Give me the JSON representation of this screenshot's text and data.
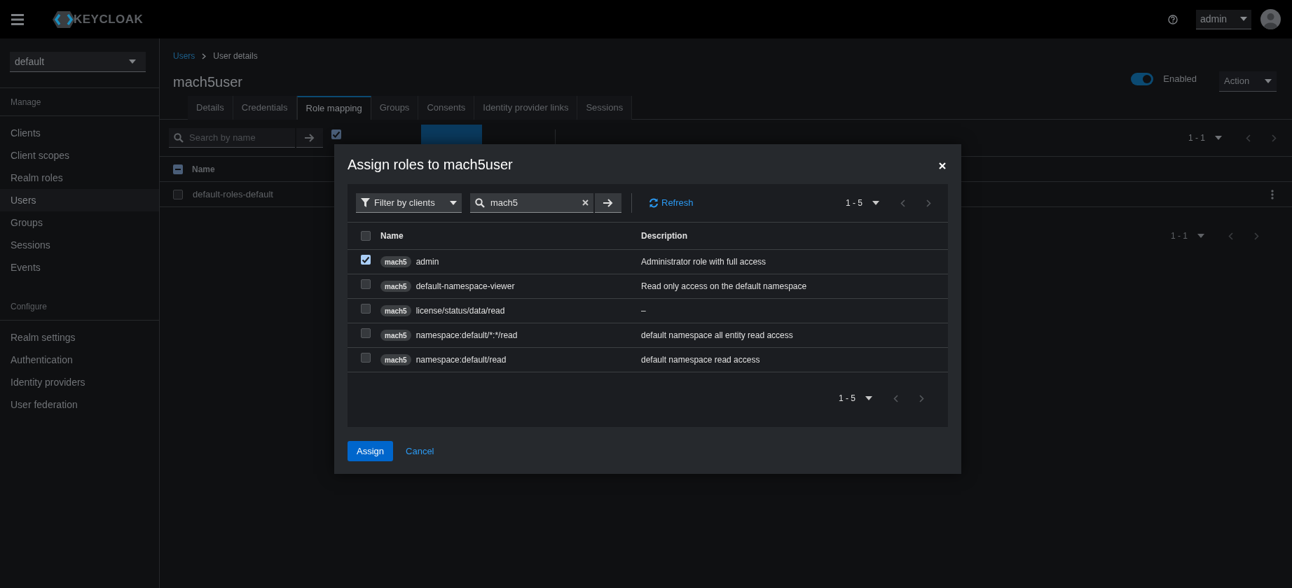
{
  "header": {
    "brand": "KEYCLOAK",
    "user_menu": "admin"
  },
  "sidebar": {
    "realm": "default",
    "sections": [
      {
        "title": "Manage",
        "items": [
          {
            "label": "Clients",
            "selected": false
          },
          {
            "label": "Client scopes",
            "selected": false
          },
          {
            "label": "Realm roles",
            "selected": false
          },
          {
            "label": "Users",
            "selected": true
          },
          {
            "label": "Groups",
            "selected": false
          },
          {
            "label": "Sessions",
            "selected": false
          },
          {
            "label": "Events",
            "selected": false
          }
        ]
      },
      {
        "title": "Configure",
        "items": [
          {
            "label": "Realm settings",
            "selected": false
          },
          {
            "label": "Authentication",
            "selected": false
          },
          {
            "label": "Identity providers",
            "selected": false
          },
          {
            "label": "User federation",
            "selected": false
          }
        ]
      }
    ]
  },
  "page": {
    "breadcrumb": [
      {
        "label": "Users",
        "kind": "link"
      },
      {
        "label": "User details",
        "kind": "current"
      }
    ],
    "title": "mach5user",
    "enabled": {
      "label": "Enabled",
      "on": true
    },
    "action_menu": "Action",
    "tabs": [
      {
        "label": "Details",
        "selected": false
      },
      {
        "label": "Credentials",
        "selected": false
      },
      {
        "label": "Role mapping",
        "selected": true
      },
      {
        "label": "Groups",
        "selected": false
      },
      {
        "label": "Consents",
        "selected": false
      },
      {
        "label": "Identity provider links",
        "selected": false
      },
      {
        "label": "Sessions",
        "selected": false
      }
    ],
    "toolbar": {
      "search_placeholder": "Search by name",
      "hide_inherited": {
        "checked": true
      },
      "pagination": "1 - 1"
    },
    "table": {
      "columns": [
        "Name"
      ],
      "header_checkbox_partial": true,
      "rows": [
        {
          "name": "default-roles-default",
          "checked": false
        }
      ]
    },
    "bottom_pagination": "1 - 1"
  },
  "modal": {
    "title": "Assign roles to mach5user",
    "filter": "Filter by clients",
    "search_value": "mach5",
    "refresh_button": "Refresh",
    "pagination": "1 - 5",
    "columns": [
      "Name",
      "Description"
    ],
    "header_checked": false,
    "rows": [
      {
        "badge": "mach5",
        "name": "admin",
        "description": "Administrator role with full access",
        "checked": true
      },
      {
        "badge": "mach5",
        "name": "default-namespace-viewer",
        "description": "Read only access on the default namespace",
        "checked": false
      },
      {
        "badge": "mach5",
        "name": "license/status/data/read",
        "description": "–",
        "checked": false
      },
      {
        "badge": "mach5",
        "name": "namespace:default/*:*/read",
        "description": "default namespace all entity read access",
        "checked": false
      },
      {
        "badge": "mach5",
        "name": "namespace:default/read",
        "description": "default namespace read access",
        "checked": false
      }
    ],
    "bottom_pagination": "1 - 5",
    "assign_button": "Assign",
    "cancel_button": "Cancel"
  }
}
